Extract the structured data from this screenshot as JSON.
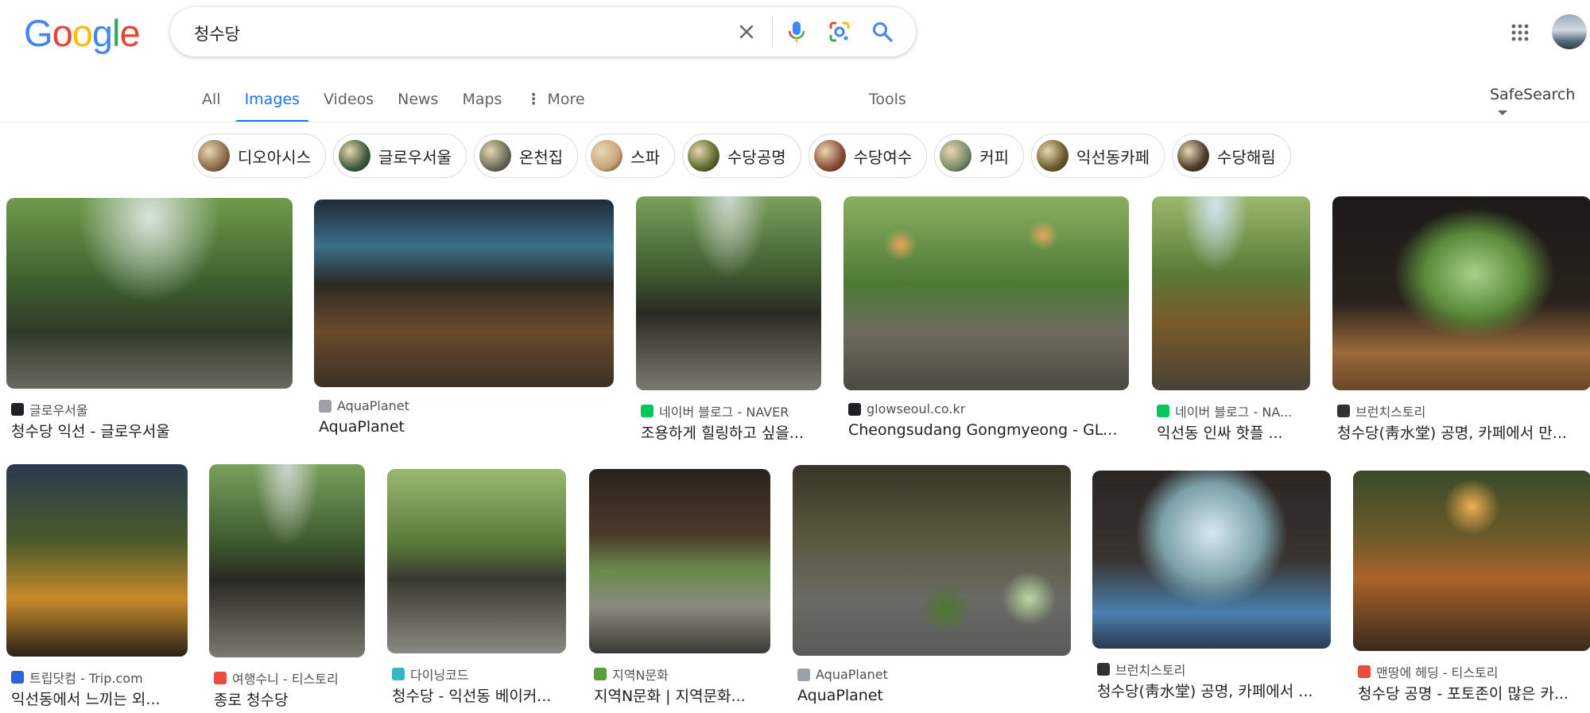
{
  "colors": {
    "accent": "#1a73e8",
    "text": "#202124",
    "muted": "#5f6368"
  },
  "logo": {
    "letters": [
      "G",
      "o",
      "o",
      "g",
      "l",
      "e"
    ],
    "colors": [
      "#4285F4",
      "#EA4335",
      "#FBBC05",
      "#4285F4",
      "#34A853",
      "#EA4335"
    ]
  },
  "search": {
    "query": "청수당",
    "icons": [
      "close-icon",
      "microphone-icon",
      "lens-camera-icon",
      "search-icon"
    ]
  },
  "header_icons": [
    "apps-grid-icon",
    "account-avatar"
  ],
  "tabs": [
    {
      "label": "All",
      "active": false
    },
    {
      "label": "Images",
      "active": true
    },
    {
      "label": "Videos",
      "active": false
    },
    {
      "label": "News",
      "active": false
    },
    {
      "label": "Maps",
      "active": false
    },
    {
      "label": "More",
      "active": false
    }
  ],
  "tools_label": "Tools",
  "safesearch_label": "SafeSearch",
  "chips": [
    {
      "label": "디오아시스",
      "color": "#8a6a4a"
    },
    {
      "label": "글로우서울",
      "color": "#3a5a3a"
    },
    {
      "label": "온천집",
      "color": "#6a6a5a"
    },
    {
      "label": "스파",
      "color": "#c9a37a"
    },
    {
      "label": "수당공명",
      "color": "#5a6a2a"
    },
    {
      "label": "수당여수",
      "color": "#8a4a3a"
    },
    {
      "label": "커피",
      "color": "#7a8a6a"
    },
    {
      "label": "익선동카페",
      "color": "#6a5a2a"
    },
    {
      "label": "수당해림",
      "color": "#4a3a2a"
    }
  ],
  "results": [
    {
      "source": "글로우서울",
      "title": "청수당 익선 - 글로우서울",
      "favicon_color": "#202124"
    },
    {
      "source": "AquaPlanet",
      "title": "AquaPlanet",
      "favicon_color": "#9aa0a6"
    },
    {
      "source": "네이버 블로그 - NAVER",
      "title": "조용하게 힐링하고 싶을...",
      "favicon_color": "#03c75a"
    },
    {
      "source": "glowseoul.co.kr",
      "title": "Cheongsudang Gongmyeong - GLOW...",
      "favicon_color": "#202124"
    },
    {
      "source": "네이버 블로그 - NA...",
      "title": "익선동 인싸 핫플 ...",
      "favicon_color": "#03c75a"
    },
    {
      "source": "브런치스토리",
      "title": "청수당(靑水堂) 공명, 카페에서 만...",
      "favicon_color": "#303134"
    },
    {
      "source": "트립닷컴 - Trip.com",
      "title": "익선동에서 느끼는 외...",
      "favicon_color": "#2a62d8"
    },
    {
      "source": "여행수니 - 티스토리",
      "title": "종로 청수당",
      "favicon_color": "#eb4c3c"
    },
    {
      "source": "다이닝코드",
      "title": "청수당 - 익선동 베이커...",
      "favicon_color": "#35b6c9"
    },
    {
      "source": "지역N문화",
      "title": "지역N문화 | 지역문화...",
      "favicon_color": "#5a9e3a"
    },
    {
      "source": "AquaPlanet",
      "title": "AquaPlanet",
      "favicon_color": "#9aa0a6"
    },
    {
      "source": "브런치스토리",
      "title": "청수당(靑水堂) 공명, 카페에서 ...",
      "favicon_color": "#303134"
    },
    {
      "source": "맨땅에 헤딩 - 티스토리",
      "title": "청수당 공명 - 포토존이 많은 카...",
      "favicon_color": "#eb4c3c"
    }
  ]
}
